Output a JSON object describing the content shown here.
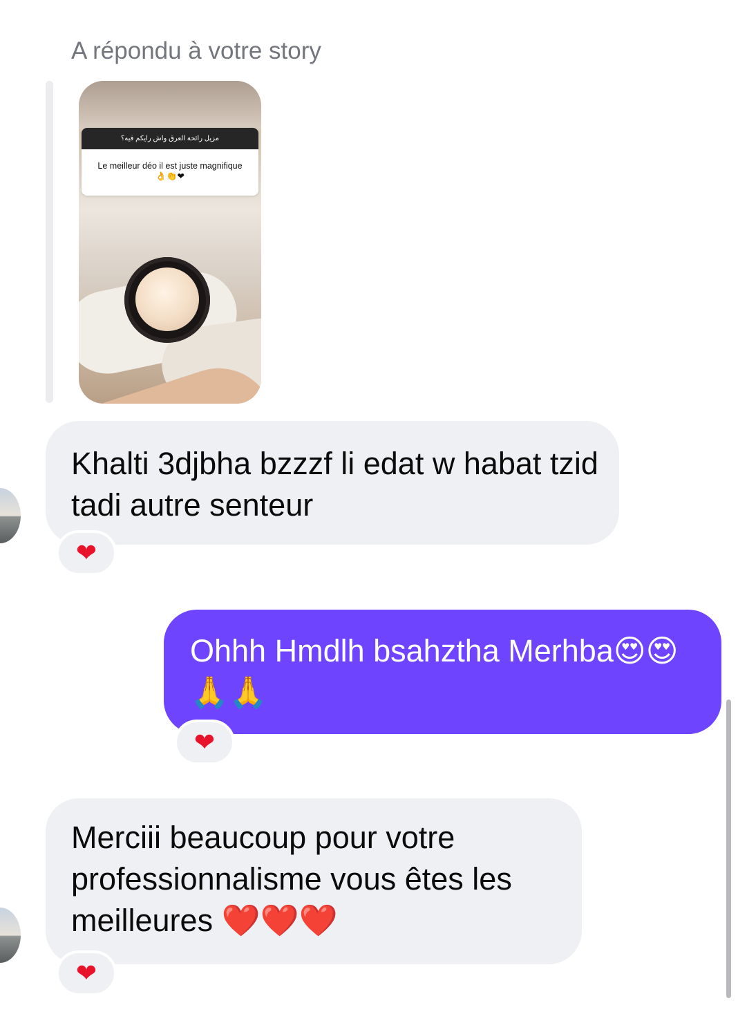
{
  "story_reply": {
    "label": "A répondu à votre story",
    "question": "مزيل رائحة العرق واش رايكم فيه؟",
    "answer": "Le meilleur déo il est juste magnifique",
    "answer_emojis": "👌👏❤"
  },
  "messages": [
    {
      "direction": "incoming",
      "text": "Khalti 3djbha bzzzf li edat w habat tzid tadi autre senteur",
      "reaction": "❤"
    },
    {
      "direction": "outgoing",
      "text": "Ohhh Hmdlh bsahztha Merhba😍😍🙏🙏",
      "reaction": "❤"
    },
    {
      "direction": "incoming",
      "text": "Merciii beaucoup pour votre professionnalisme vous êtes les meilleures ❤️❤️❤️",
      "reaction": "❤"
    }
  ],
  "colors": {
    "outgoing_bubble": "#6e44ff",
    "incoming_bubble": "#eff0f4",
    "reply_label": "#73767c",
    "reaction_heart": "#e8132b"
  }
}
